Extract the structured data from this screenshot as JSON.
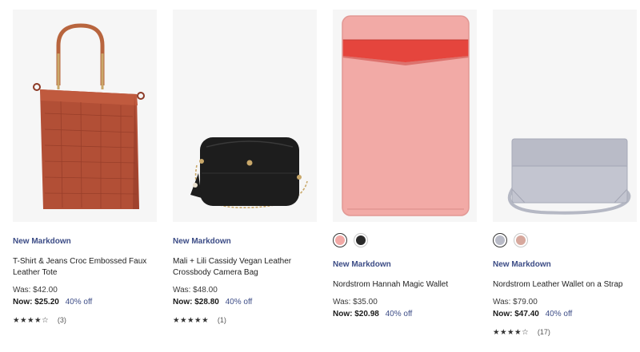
{
  "products": [
    {
      "badge": "New Markdown",
      "name": "T-Shirt & Jeans Croc Embossed Faux Leather Tote",
      "was": "Was: $42.00",
      "now_label": "Now:",
      "now_price": "$25.20",
      "discount": "40% off",
      "stars": "★★★★☆",
      "rating": 3.5,
      "review_count": "(3)",
      "image_icon": "croc-tote-bag-icon"
    },
    {
      "badge": "New Markdown",
      "name": "Mali + Lili Cassidy Vegan Leather Crossbody Camera Bag",
      "was": "Was: $48.00",
      "now_label": "Now:",
      "now_price": "$28.80",
      "discount": "40% off",
      "stars": "★★★★★",
      "rating": 5,
      "review_count": "(1)",
      "image_icon": "camera-bag-icon"
    },
    {
      "badge": "New Markdown",
      "name": "Nordstrom Hannah Magic Wallet",
      "was": "Was: $35.00",
      "now_label": "Now:",
      "now_price": "$20.98",
      "discount": "40% off",
      "swatches": [
        {
          "color": "#f2a9a6",
          "selected": true
        },
        {
          "color": "#2a2a2a",
          "selected": false
        }
      ],
      "image_icon": "magic-wallet-icon"
    },
    {
      "badge": "New Markdown",
      "name": "Nordstrom Leather Wallet on a Strap",
      "was": "Was: $79.00",
      "now_label": "Now:",
      "now_price": "$47.40",
      "discount": "40% off",
      "stars": "★★★★☆",
      "rating": 4.5,
      "review_count": "(17)",
      "swatches": [
        {
          "color": "#b9bbc7",
          "selected": true
        },
        {
          "color": "#d7a89d",
          "selected": false
        }
      ],
      "image_icon": "wallet-on-strap-icon"
    }
  ],
  "colors": {
    "badge": "#3c4c86",
    "discount": "#3c4c86",
    "image_background": "#f6f6f6"
  }
}
